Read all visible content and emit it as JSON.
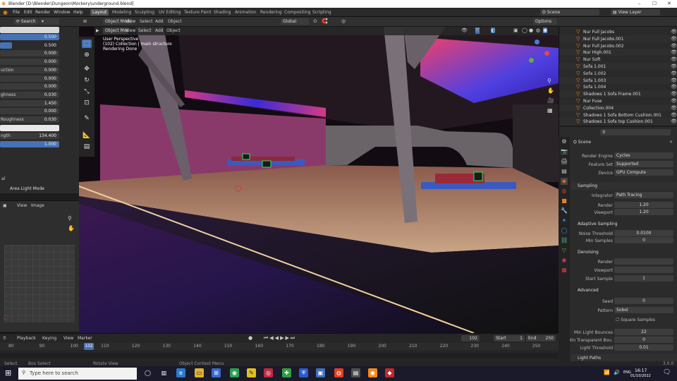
{
  "window": {
    "title": "Blender [D:\\Blender\\Dungeon\\Mockery\\underground.blend]",
    "controls": [
      "–",
      "☐",
      "✕"
    ]
  },
  "menu": [
    "File",
    "Edit",
    "Render",
    "Window",
    "Help"
  ],
  "workspaces": [
    "Layout",
    "Modeling",
    "Sculpting",
    "UV Editing",
    "Texture Paint",
    "Shading",
    "Animation",
    "Rendering",
    "Compositing",
    "Scripting"
  ],
  "scene": {
    "label": "Scene",
    "view_layer": "View Layer"
  },
  "header2": {
    "mode": "Object Mode",
    "view": "View",
    "select": "Select",
    "add": "Add",
    "object": "Object",
    "orientation": "Global",
    "options": "Options"
  },
  "viewport_info": {
    "line1": "User Perspective",
    "line2": "(102) Collection | main structure",
    "line3": "Rendering Done"
  },
  "left_panel": {
    "rows": [
      {
        "label": "",
        "value": "0.500",
        "fill": 1
      },
      {
        "label": "",
        "value": "0.500",
        "fill": 0.2
      },
      {
        "label": "",
        "value": "0.000",
        "fill": 0
      },
      {
        "label": "",
        "value": "0.000",
        "fill": 0
      },
      {
        "label": "uction",
        "value": "0.000",
        "fill": 0
      },
      {
        "label": "",
        "value": "0.000",
        "fill": 0
      },
      {
        "label": "",
        "value": "0.000",
        "fill": 0
      },
      {
        "label": "ghness",
        "value": "0.030",
        "fill": 0
      },
      {
        "label": "",
        "value": "1.450",
        "fill": 0
      },
      {
        "label": "",
        "value": "0.000",
        "fill": 0
      },
      {
        "label": "Roughness",
        "value": "0.030",
        "fill": 0
      },
      {
        "label": "",
        "value": "",
        "fill": 0
      },
      {
        "label": "ngth",
        "value": "134.400",
        "fill": 0
      },
      {
        "label": "",
        "value": "1.000",
        "fill": 1
      }
    ],
    "footer1": "al",
    "footer2": "Area Light Mode"
  },
  "image_editor": {
    "view": "View",
    "image": "Image"
  },
  "outliner": {
    "items": [
      "Nur Full Jacobs",
      "Nur Full Jacobs.001",
      "Nur Full Jacobs.002",
      "Nur High.001",
      "Nur Soft",
      "Sofa 1.001",
      "Sofa 1.002",
      "Sofa 1.003",
      "Sofa 1.004",
      "Shadows 1 Sofa Frame.001",
      "Nur Fuse",
      "Collection.004",
      "Shadows 1 Sofa Bottom Cushion.001",
      "Shadows 1 Sofa top Cushion.001"
    ]
  },
  "properties": {
    "scene_label": "Scene",
    "render_engine": {
      "key": "Render Engine",
      "value": "Cycles"
    },
    "feature_set": {
      "key": "Feature Set",
      "value": "Supported"
    },
    "device": {
      "key": "Device",
      "value": "GPU Compute"
    },
    "sampling": "Sampling",
    "integrator": {
      "key": "Integrator",
      "value": "Path Tracing"
    },
    "render_samples": {
      "key": "Render",
      "value": "1.20"
    },
    "viewport_samples": {
      "key": "Viewport",
      "value": "1.20"
    },
    "adaptive": "Adaptive Sampling",
    "noise_threshold": {
      "key": "Noise Threshold",
      "value": "0.0100"
    },
    "min_samples": {
      "key": "Min Samples",
      "value": "0"
    },
    "denoising": "Denoising",
    "den_render": "Render",
    "den_viewport": "Viewport",
    "start_sample": {
      "key": "Start Sample",
      "value": "1"
    },
    "advanced": "Advanced",
    "seed": {
      "key": "Seed",
      "value": "0"
    },
    "pattern": {
      "key": "Pattern",
      "value": "Sobol"
    },
    "square": "Square Samples",
    "min_light": {
      "key": "Min Light Bounces",
      "value": "22"
    },
    "min_transp": {
      "key": "Min Transparent Bou.",
      "value": "0"
    },
    "light_thresh": {
      "key": "Light Threshold",
      "value": "0.01"
    },
    "light_paths": "Light Paths"
  },
  "timeline": {
    "playback": "Playback",
    "keying": "Keying",
    "view": "View",
    "marker": "Marker",
    "frame": "102",
    "start_label": "Start",
    "start": "1",
    "end_label": "End",
    "end": "250",
    "ticks": [
      "80",
      "90",
      "100",
      "110",
      "120",
      "130",
      "140",
      "150",
      "160",
      "170",
      "180",
      "190",
      "200",
      "210",
      "220",
      "230",
      "240",
      "250"
    ],
    "playhead": "102"
  },
  "statusbar": {
    "left": "Select",
    "mid": "Box Select",
    "mid2": "Rotate View",
    "mid3": "Object Context Menu",
    "right": "3.0.0"
  },
  "taskbar": {
    "search": "Type here to search",
    "time": "16:17",
    "date": "01/10/2022",
    "lang": "ENG"
  }
}
